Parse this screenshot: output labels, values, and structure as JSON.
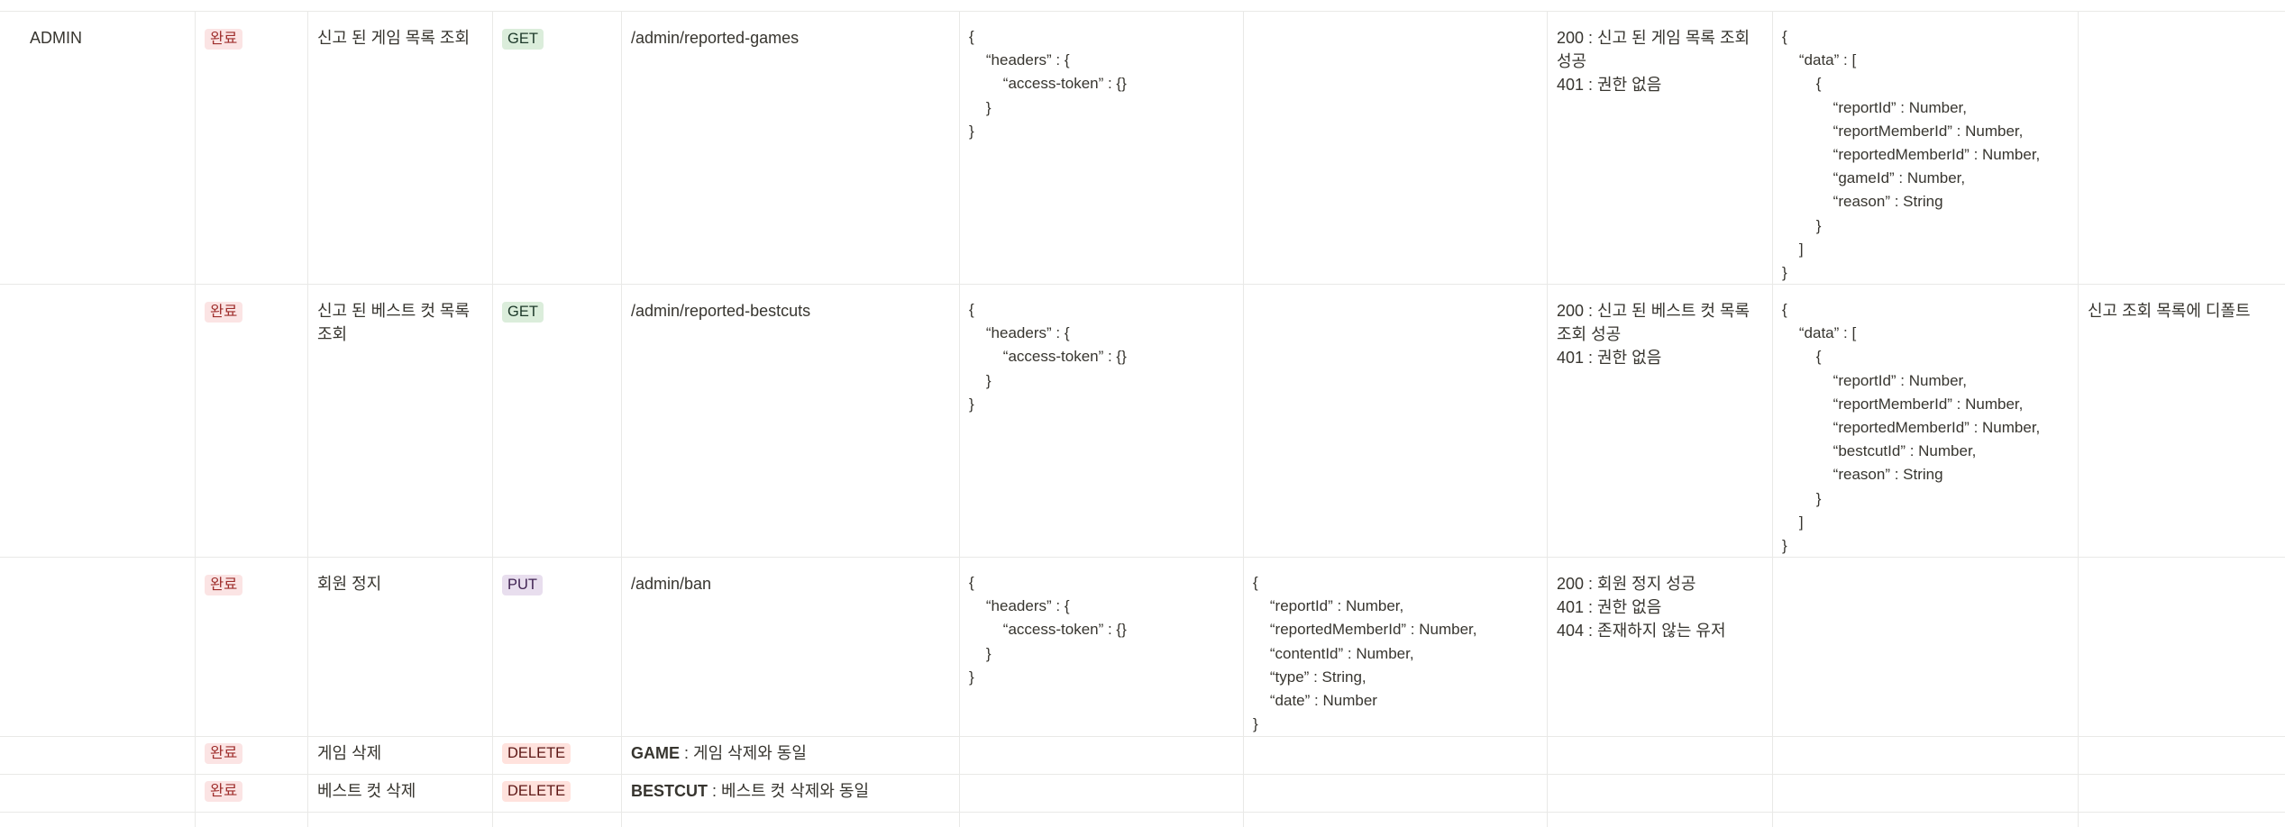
{
  "rows": [
    {
      "category": "ADMIN",
      "status": "완료",
      "feature": "신고 된 게임 목록 조회",
      "method": "GET",
      "method_style": "get",
      "endpoint": "/admin/reported-games",
      "request_header": "{\n    “headers” : {\n        “access-token” : {}\n    }\n}",
      "request_body": "",
      "responses": [
        "200 : 신고 된  게임 목록 조회",
        "성공",
        "401 : 권한 없음"
      ],
      "response_body": "{\n    “data” : [\n        {\n            “reportId” : Number,\n            “reportMemberId” : Number,\n            “reportedMemberId” : Number,\n            “gameId” : Number,\n            “reason” : String\n        }\n    ]\n}",
      "note": ""
    },
    {
      "category": "",
      "status": "완료",
      "feature": "신고 된 베스트 컷 목록 조회",
      "method": "GET",
      "method_style": "get",
      "endpoint": "/admin/reported-bestcuts",
      "request_header": "{\n    “headers” : {\n        “access-token” : {}\n    }\n}",
      "request_body": "",
      "responses": [
        "200 : 신고 된  베스트 컷 목록",
        "조회 성공",
        "401 : 권한 없음"
      ],
      "response_body": "{\n    “data” : [\n        {\n            “reportId” : Number,\n            “reportMemberId” : Number,\n            “reportedMemberId” : Number,\n            “bestcutId” : Number,\n            “reason” : String\n        }\n    ]\n}",
      "note": "신고 조회 목록에 디폴트"
    },
    {
      "category": "",
      "status": "완료",
      "feature": "회원 정지",
      "method": "PUT",
      "method_style": "put",
      "endpoint": "/admin/ban",
      "request_header": "{\n    “headers” : {\n        “access-token” : {}\n    }\n}",
      "request_body": "{\n    “reportId” : Number,\n    “reportedMemberId” : Number,\n    “contentId” : Number,\n    “type” : String,\n    “date” : Number\n}",
      "responses": [
        "200 : 회원 정지 성공",
        "401 : 권한 없음",
        "404 : 존재하지 않는 유저"
      ],
      "response_body": "",
      "note": ""
    },
    {
      "category": "",
      "status": "완료",
      "feature": "게임 삭제",
      "method": "DELETE",
      "method_style": "delete",
      "endpoint_bold": "GAME",
      "endpoint_rest": " : 게임 삭제와 동일"
    },
    {
      "category": "",
      "status": "완료",
      "feature": "베스트 컷 삭제",
      "method": "DELETE",
      "method_style": "delete",
      "endpoint_bold": "BESTCUT",
      "endpoint_rest": " : 베스트 컷 삭제와 동일"
    }
  ]
}
